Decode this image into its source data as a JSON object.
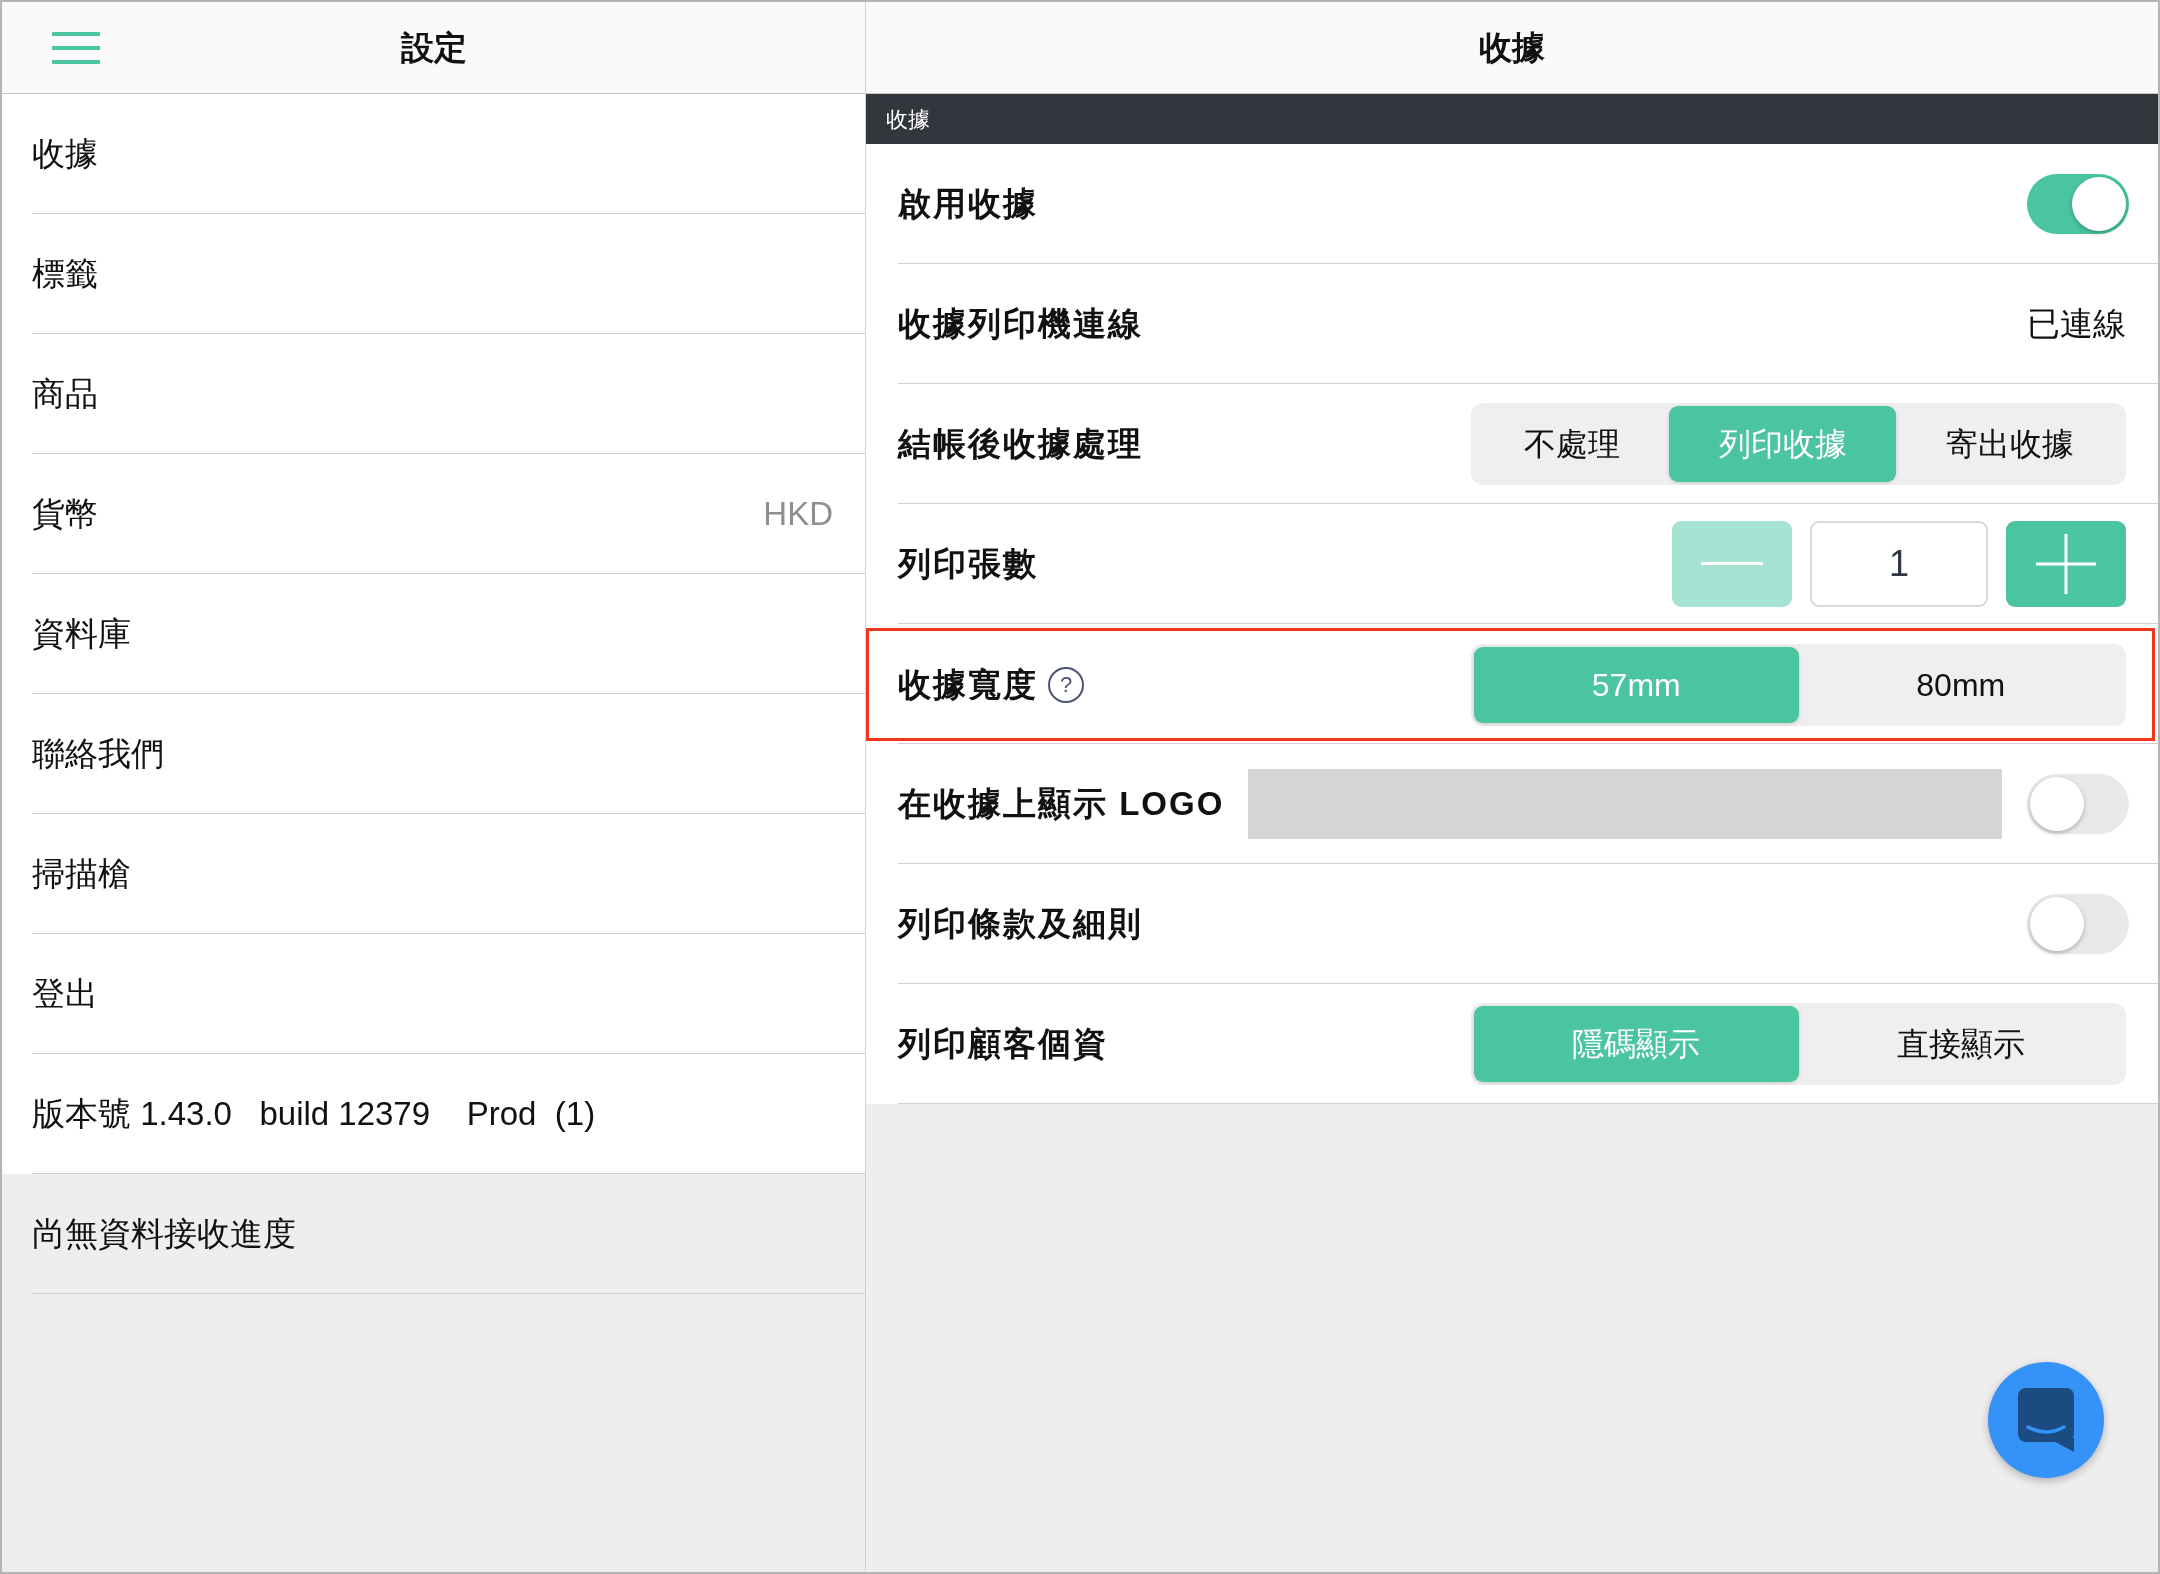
{
  "left_panel": {
    "title": "設定",
    "items": [
      {
        "label": "收據"
      },
      {
        "label": "標籤"
      },
      {
        "label": "商品"
      },
      {
        "label": "貨幣",
        "value": "HKD"
      },
      {
        "label": "資料庫"
      },
      {
        "label": "聯絡我們"
      },
      {
        "label": "掃描槍"
      },
      {
        "label": "登出"
      }
    ],
    "version": "版本號 1.43.0   build 12379    Prod  (1)",
    "sync_status": "尚無資料接收進度"
  },
  "right_panel": {
    "title": "收據",
    "section": "收據",
    "rows": [
      {
        "kind": "toggle",
        "label": "啟用收據",
        "on": true,
        "highlighted": false
      },
      {
        "kind": "value",
        "label": "收據列印機連線",
        "value": "已連線",
        "highlighted": false
      },
      {
        "kind": "segmented",
        "label": "結帳後收據處理",
        "options": [
          {
            "label": "不處理",
            "selected": false
          },
          {
            "label": "列印收據",
            "selected": true
          },
          {
            "label": "寄出收據",
            "selected": false
          }
        ],
        "highlighted": false
      },
      {
        "kind": "stepper",
        "label": "列印張數",
        "value": "1",
        "minus_disabled": true,
        "plus_disabled": false,
        "highlighted": false
      },
      {
        "kind": "segmented",
        "label": "收據寬度",
        "help": "?",
        "options": [
          {
            "label": "57mm",
            "selected": true
          },
          {
            "label": "80mm",
            "selected": false
          }
        ],
        "highlighted": true
      },
      {
        "kind": "toggle",
        "label": "在收據上顯示 LOGO",
        "blocked_area": true,
        "on": false,
        "highlighted": false
      },
      {
        "kind": "toggle",
        "label": "列印條款及細則",
        "on": false,
        "highlighted": false
      },
      {
        "kind": "segmented",
        "label": "列印顧客個資",
        "options": [
          {
            "label": "隱碼顯示",
            "selected": true
          },
          {
            "label": "直接顯示",
            "selected": false
          }
        ],
        "highlighted": false
      }
    ]
  }
}
